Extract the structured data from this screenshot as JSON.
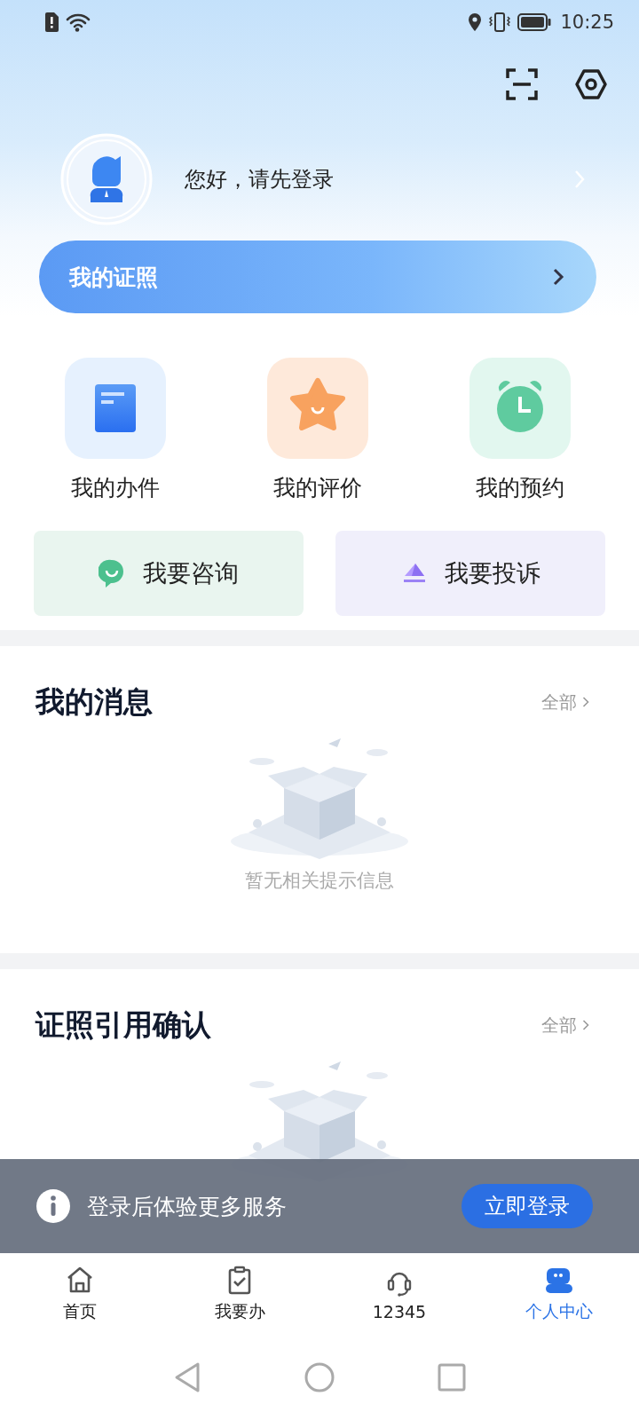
{
  "status_bar": {
    "time": "10:25"
  },
  "profile": {
    "greeting": "您好，请先登录"
  },
  "certificate_bar": {
    "title": "我的证照"
  },
  "shortcuts": [
    {
      "kind": "doc",
      "label": "我的办件"
    },
    {
      "kind": "star",
      "label": "我的评价"
    },
    {
      "kind": "clock",
      "label": "我的预约"
    }
  ],
  "actions": [
    {
      "kind": "consult",
      "label": "我要咨询"
    },
    {
      "kind": "complaint",
      "label": "我要投诉"
    }
  ],
  "sections": [
    {
      "title": "我的消息",
      "more": "全部",
      "empty_text": "暂无相关提示信息"
    },
    {
      "title": "证照引用确认",
      "more": "全部"
    }
  ],
  "login_banner": {
    "text": "登录后体验更多服务",
    "button": "立即登录"
  },
  "bottom_nav": [
    {
      "kind": "home",
      "label": "首页",
      "selected": false
    },
    {
      "kind": "todo",
      "label": "我要办",
      "selected": false
    },
    {
      "kind": "hotline",
      "label": "12345",
      "selected": false
    },
    {
      "kind": "profile",
      "label": "个人中心",
      "selected": true
    }
  ]
}
